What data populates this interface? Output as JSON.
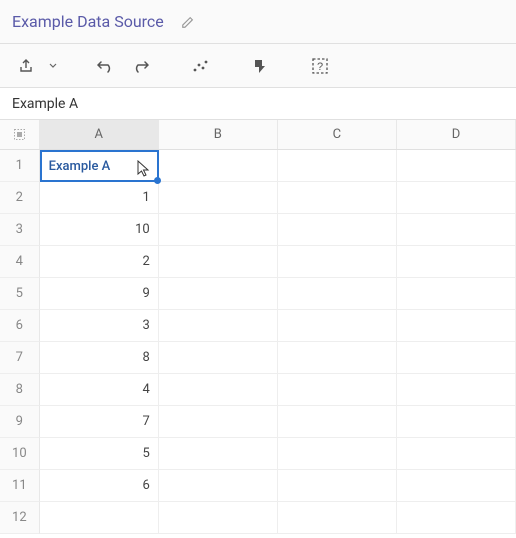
{
  "title": "Example Data Source",
  "formula_value": "Example A",
  "columns": [
    "A",
    "B",
    "C",
    "D"
  ],
  "selected_column_index": 0,
  "selected_cell": {
    "row": 1,
    "col": "A"
  },
  "rows": [
    {
      "n": 1,
      "A": "Example A",
      "B": "",
      "C": "",
      "D": ""
    },
    {
      "n": 2,
      "A": "1",
      "B": "",
      "C": "",
      "D": ""
    },
    {
      "n": 3,
      "A": "10",
      "B": "",
      "C": "",
      "D": ""
    },
    {
      "n": 4,
      "A": "2",
      "B": "",
      "C": "",
      "D": ""
    },
    {
      "n": 5,
      "A": "9",
      "B": "",
      "C": "",
      "D": ""
    },
    {
      "n": 6,
      "A": "3",
      "B": "",
      "C": "",
      "D": ""
    },
    {
      "n": 7,
      "A": "8",
      "B": "",
      "C": "",
      "D": ""
    },
    {
      "n": 8,
      "A": "4",
      "B": "",
      "C": "",
      "D": ""
    },
    {
      "n": 9,
      "A": "7",
      "B": "",
      "C": "",
      "D": ""
    },
    {
      "n": 10,
      "A": "5",
      "B": "",
      "C": "",
      "D": ""
    },
    {
      "n": 11,
      "A": "6",
      "B": "",
      "C": "",
      "D": ""
    },
    {
      "n": 12,
      "A": "",
      "B": "",
      "C": "",
      "D": ""
    }
  ],
  "icons": {
    "share": "share-icon",
    "undo": "undo-icon",
    "redo": "redo-icon",
    "chart": "chart-icon",
    "action": "action-icon",
    "help": "help-icon",
    "edit": "pencil-icon",
    "select_all": "select-all-icon",
    "dropdown": "chevron-down-icon"
  }
}
